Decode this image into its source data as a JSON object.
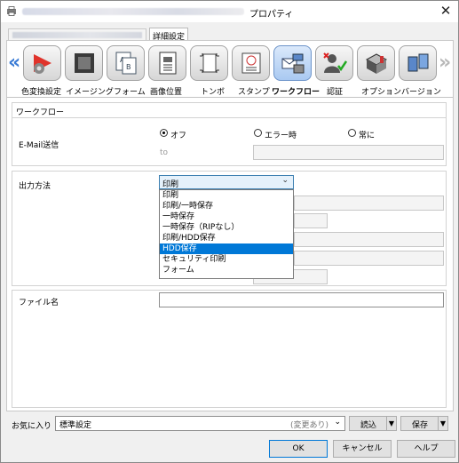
{
  "window": {
    "title": "プロパティ",
    "close": "✕"
  },
  "tabs": {
    "active": "詳細設定"
  },
  "categories": [
    {
      "label": "色変換設定",
      "icon": "color-conversion-icon"
    },
    {
      "label": "イメージング",
      "icon": "imaging-icon"
    },
    {
      "label": "フォーム",
      "icon": "form-icon"
    },
    {
      "label": "画像位置",
      "icon": "image-position-icon"
    },
    {
      "label": "トンボ",
      "icon": "crop-marks-icon"
    },
    {
      "label": "スタンプ",
      "icon": "stamp-icon"
    },
    {
      "label": "ワークフロー",
      "icon": "workflow-icon",
      "selected": true
    },
    {
      "label": "認証",
      "icon": "authentication-icon"
    },
    {
      "label": "オプション",
      "icon": "options-icon"
    },
    {
      "label": "バージョン",
      "icon": "version-icon"
    }
  ],
  "nav": {
    "prev": "«",
    "next": "»"
  },
  "workflow": {
    "section_title": "ワークフロー",
    "email": {
      "label": "E-Mail送信",
      "options": [
        "オフ",
        "エラー時",
        "常に"
      ],
      "selected": "オフ",
      "to_label": "to"
    },
    "output": {
      "label": "出力方法",
      "value": "印刷",
      "options": [
        "印刷",
        "印刷/一時保存",
        "一時保存",
        "一時保存（RIPなし）",
        "印刷/HDD保存",
        "HDD保存",
        "セキュリティ印刷",
        "フォーム"
      ],
      "highlighted": "HDD保存"
    },
    "filename": {
      "label": "ファイル名",
      "value": ""
    }
  },
  "favorites": {
    "label": "お気に入り",
    "value": "標準設定",
    "note": "(変更あり)",
    "load": "読込",
    "save": "保存"
  },
  "buttons": {
    "ok": "OK",
    "cancel": "キャンセル",
    "help": "ヘルプ"
  },
  "colors": {
    "accent": "#0078d7",
    "selected_icon": "#a9c9f1"
  }
}
